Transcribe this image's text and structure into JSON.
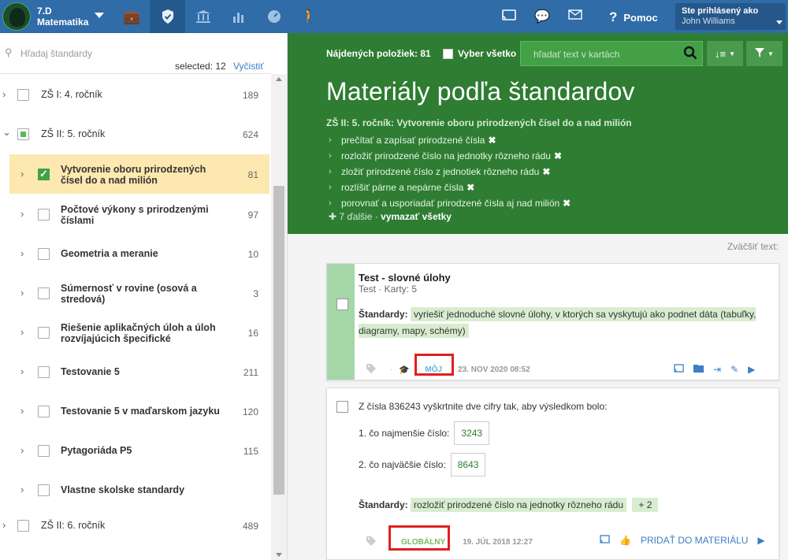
{
  "topbar": {
    "class_code": "7.D",
    "subject": "Matematika",
    "help_label": "Pomoc",
    "user_label": "Ste prihlásený ako",
    "user_name": "John Williams"
  },
  "left": {
    "search_placeholder": "Hľadaj štandardy",
    "selected_text": "selected: 12",
    "clear_label": "Vyčistiť",
    "items": [
      {
        "label": "ZŠ I: 4. ročník",
        "count": "189"
      },
      {
        "label": "ZŠ II: 5. ročník",
        "count": "624"
      },
      {
        "label": "Vytvorenie oboru prirodzených čísel do a nad milión",
        "count": "81"
      },
      {
        "label": "Počtové výkony s prirodzenými číslami",
        "count": "97"
      },
      {
        "label": "Geometria a meranie",
        "count": "10"
      },
      {
        "label": "Súmernosť v rovine (osová a stredová)",
        "count": "3"
      },
      {
        "label": "Riešenie aplikačných úloh a úloh rozvíjajúcich špecifické",
        "count": "16"
      },
      {
        "label": "Testovanie 5",
        "count": "211"
      },
      {
        "label": "Testovanie 5 v maďarskom jazyku",
        "count": "120"
      },
      {
        "label": "Pytagoriáda P5",
        "count": "115"
      },
      {
        "label": "Vlastne skolske standardy",
        "count": ""
      },
      {
        "label": "ZŠ II: 6. ročník",
        "count": "489"
      }
    ]
  },
  "right": {
    "found_label": "Nájdených položiek: 81",
    "select_all_label": "Vyber všetko",
    "search_placeholder": "hľadať text v kartách",
    "title": "Materiály podľa štandardov",
    "standard_group": "ZŠ II: 5. ročník: Vytvorenie oboru prirodzených čísel do a nad milión",
    "standards": [
      "prečítať a zapísať prirodzené čísla",
      "rozložiť prirodzené číslo na jednotky rôzneho rádu",
      "zložiť prirodzené číslo z jednotiek rôzneho rádu",
      "rozlíšiť párne a nepárne čísla",
      "porovnať a usporiadať prirodzené čísla aj nad milión"
    ],
    "more_count": "7 ďalšie ·",
    "clear_all": "vymazať všetky",
    "zoom_label": "Zväčšiť text:"
  },
  "card1": {
    "title": "Test - slovné úlohy",
    "meta": "Test · Karty: 5",
    "std_label": "Štandardy:",
    "std_text": "vyriešiť jednoduché slovné úlohy, v ktorých sa vyskytujú ako podnet dáta (tabuľky, diagramy, mapy, schémy)",
    "owner_badge": "MÔJ",
    "date": "23. NOV 2020 08:52"
  },
  "card2": {
    "question": "Z čísla 836243 vyškrtnite dve cifry tak, aby výsledkom bolo:",
    "q1": "1. čo najmenšie číslo:",
    "a1": "3243",
    "q2": "2. čo najväčšie číslo:",
    "a2": "8643",
    "std_label": "Štandardy:",
    "std_text": "rozložiť prirodzené číslo na jednotky rôzneho rádu",
    "std_more": "+ 2",
    "owner_badge": "GLOBÁLNY",
    "date": "19. JÚL 2018 12:27",
    "add_label": "PRIDAŤ DO MATERIÁLU"
  }
}
